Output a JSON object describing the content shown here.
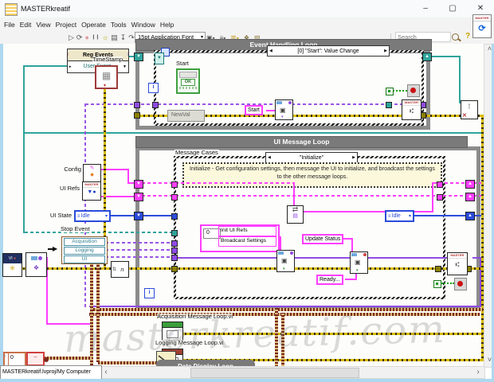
{
  "window": {
    "title": "MASTERkreatif"
  },
  "menu": {
    "items": [
      "File",
      "Edit",
      "View",
      "Project",
      "Operate",
      "Tools",
      "Window",
      "Help"
    ]
  },
  "toolbar": {
    "font": "15pt Application Font",
    "search_placeholder": "Search"
  },
  "icons": {
    "run": "▷",
    "run_continuous": "⟳",
    "abort": "●",
    "pause": "❙❙",
    "highlight": "☼",
    "retain": "▤",
    "step_into": "↧",
    "step_over": "↷",
    "step_out": "↥",
    "align": "▣",
    "distribute": "≡",
    "resize": "▥",
    "reorder": "❖",
    "cleanup": "▨",
    "dropdown": "▾",
    "help": "?",
    "refresh": "⟳",
    "scroll_up": "˄",
    "scroll_down": "˅",
    "scroll_left": "‹",
    "scroll_right": "›",
    "min": "–",
    "max": "▢",
    "close": "✕",
    "index_arrow": "▶"
  },
  "reg_events": {
    "title": "Reg Events",
    "source": "User Event",
    "timestamp_label": "TimeStamp"
  },
  "event_loop": {
    "title": "Event Handling Loop",
    "selector": "[0] \"Start\": Value Change",
    "start_label": "Start",
    "newval_label": "NewVal",
    "start_constant": "Start",
    "iteration": "i"
  },
  "ui_loop": {
    "title": "UI Message Loop",
    "cases_label": "Message Cases",
    "selector": "\"Initialize\"",
    "comment": "Initialize - Get configuration settings, then message the UI to initialize, and broadcast the settings to the other message loops.",
    "iteration": "i",
    "idle_enum": "Idle",
    "index_value": "0",
    "strings": {
      "init": "Init UI Refs",
      "broadcast": "Broadcast Settings",
      "update": "Update Status",
      "ready": "Ready..."
    }
  },
  "left_panel": {
    "config": "Config",
    "ui_refs": "UI Refs",
    "ui_state": "UI State",
    "ui_state_value": "Idle",
    "stop_event": "Stop Event",
    "cluster": [
      "Acquisition",
      "Logging",
      "UI"
    ]
  },
  "bottom": {
    "acquisition_vi": "Acquisition Message Loop.vi",
    "logging_vi": "Logging Message Loop.vi",
    "data_display": "Data Display Loop",
    "error_code": "0"
  },
  "status_bar": {
    "path": "MASTERkreatif.lvproj/My Computer"
  },
  "watermark": "masterkreatif.com",
  "nodes": {
    "master": "MASTER",
    "index_n": "n",
    "ok": "OK",
    "vi": "VI"
  }
}
